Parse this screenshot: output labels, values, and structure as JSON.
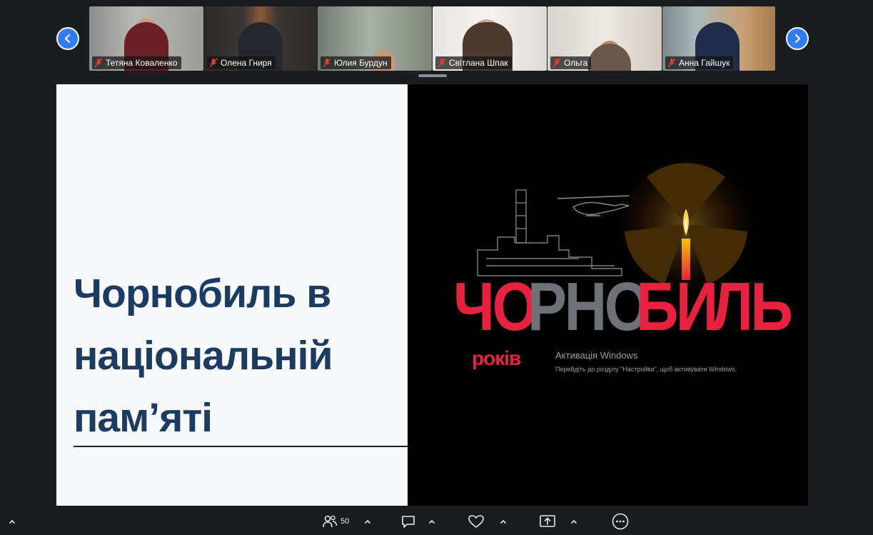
{
  "participants": [
    {
      "name": "Тетяна Коваленко"
    },
    {
      "name": "Олена Гниря"
    },
    {
      "name": "Юлия Бурдун"
    },
    {
      "name": "Світлана Шпак"
    },
    {
      "name": "Ольга"
    },
    {
      "name": "Анна Гайшук"
    }
  ],
  "slide": {
    "title_line1": "Чорнобиль в",
    "title_line2": "національній",
    "title_line3": "памʼяті",
    "poster": {
      "part1": "ЧО",
      "part2": "РНО",
      "part3": "БИ",
      "part4": "ЛЬ",
      "years": "років"
    }
  },
  "activation": {
    "title": "Активація Windows",
    "body": "Перейдіть до розділу \"Настройки\", щоб активувати Windows."
  },
  "toolbar": {
    "participants_count": "50"
  },
  "colors": {
    "accent_blue": "#2f7cf6",
    "title_navy": "#1c3b63",
    "poster_red": "#e8213f",
    "poster_grey": "#6e7175",
    "mic_off_red": "#e53935"
  }
}
